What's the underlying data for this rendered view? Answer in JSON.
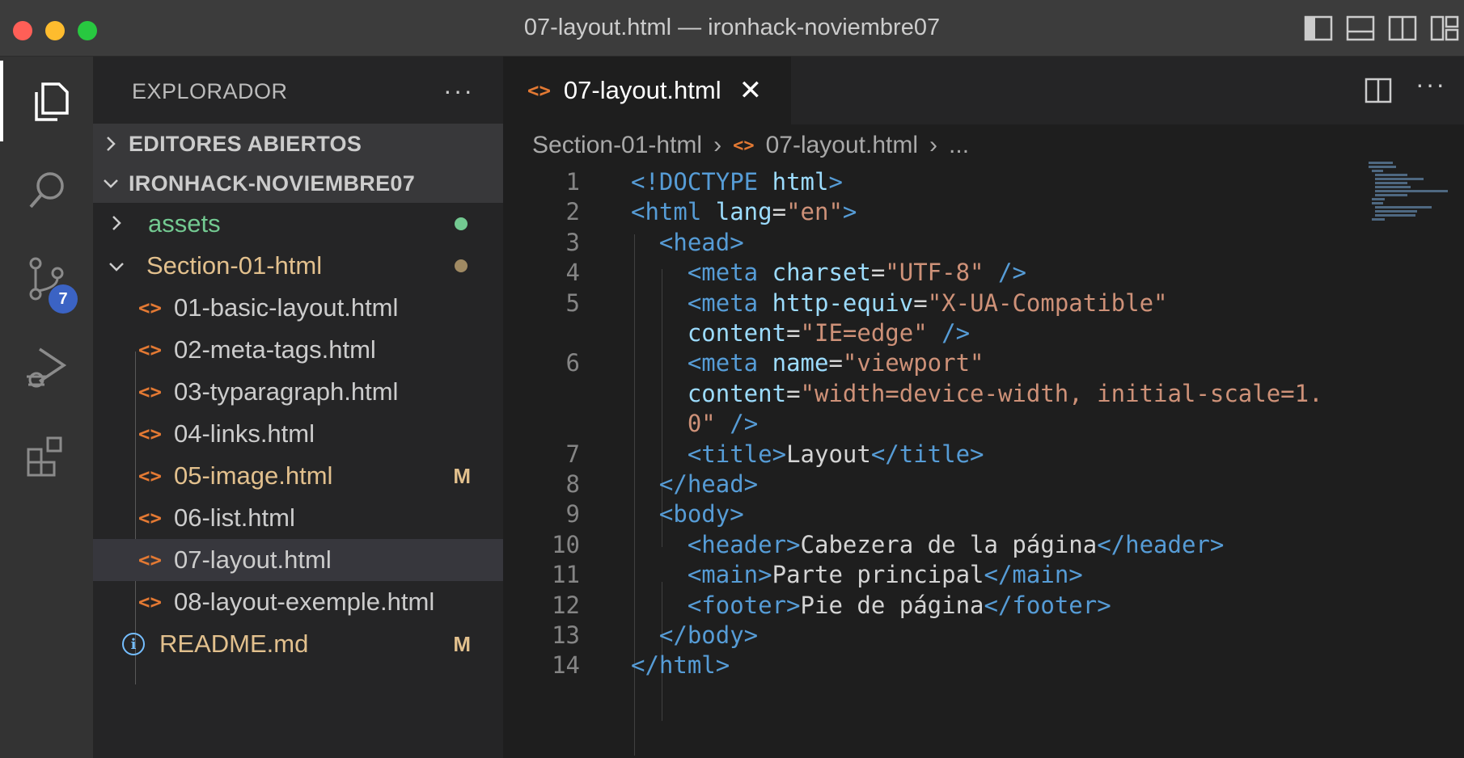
{
  "window": {
    "title": "07-layout.html — ironhack-noviembre07"
  },
  "activity_bar": {
    "items": [
      {
        "name": "explorer-icon"
      },
      {
        "name": "search-icon"
      },
      {
        "name": "source-control-icon",
        "badge": "7"
      },
      {
        "name": "run-debug-icon"
      },
      {
        "name": "extensions-icon"
      }
    ]
  },
  "sidebar": {
    "title": "EXPLORADOR",
    "more": "···",
    "sections": {
      "open_editors": "EDITORES ABIERTOS",
      "workspace": "IRONHACK-NOVIEMBRE07"
    },
    "tree": [
      {
        "name": "assets",
        "type": "folder",
        "collapsed": true,
        "color": "#73c991",
        "dot": "#73c991"
      },
      {
        "name": "Section-01-html",
        "type": "folder",
        "collapsed": false,
        "color": "#e2c08d",
        "dot": "#a08a63"
      },
      {
        "name": "01-basic-layout.html",
        "type": "file",
        "color": "#cccccc"
      },
      {
        "name": "02-meta-tags.html",
        "type": "file",
        "color": "#cccccc"
      },
      {
        "name": "03-typaragraph.html",
        "type": "file",
        "color": "#cccccc"
      },
      {
        "name": "04-links.html",
        "type": "file",
        "color": "#cccccc"
      },
      {
        "name": "05-image.html",
        "type": "file",
        "color": "#e2c08d",
        "decoration": "M"
      },
      {
        "name": "06-list.html",
        "type": "file",
        "color": "#cccccc"
      },
      {
        "name": "07-layout.html",
        "type": "file",
        "color": "#cccccc",
        "selected": true
      },
      {
        "name": "08-layout-exemple.html",
        "type": "file",
        "color": "#cccccc"
      },
      {
        "name": "README.md",
        "type": "info",
        "color": "#e2c08d",
        "decoration": "M"
      }
    ]
  },
  "editor": {
    "tab": {
      "label": "07-layout.html",
      "close": "✕"
    },
    "more": "···",
    "breadcrumb": {
      "folder": "Section-01-html",
      "file": "07-layout.html",
      "ellipsis": "..."
    },
    "lines": [
      {
        "n": "1",
        "segs": [
          [
            "t",
            "<!DOCTYPE "
          ],
          [
            "a",
            "html"
          ],
          [
            "t",
            ">"
          ]
        ]
      },
      {
        "n": "2",
        "segs": [
          [
            "t",
            "<html "
          ],
          [
            "a",
            "lang"
          ],
          [
            "w",
            "="
          ],
          [
            "s",
            "\"en\""
          ],
          [
            "t",
            ">"
          ]
        ]
      },
      {
        "n": "3",
        "segs": [
          [
            "w",
            "  "
          ],
          [
            "t",
            "<head>"
          ]
        ]
      },
      {
        "n": "4",
        "segs": [
          [
            "w",
            "    "
          ],
          [
            "t",
            "<meta "
          ],
          [
            "a",
            "charset"
          ],
          [
            "w",
            "="
          ],
          [
            "s",
            "\"UTF-8\""
          ],
          [
            "w",
            " "
          ],
          [
            "t",
            "/>"
          ]
        ]
      },
      {
        "n": "5",
        "segs": [
          [
            "w",
            "    "
          ],
          [
            "t",
            "<meta "
          ],
          [
            "a",
            "http-equiv"
          ],
          [
            "w",
            "="
          ],
          [
            "s",
            "\"X-UA-Compatible\""
          ]
        ]
      },
      {
        "n": "",
        "segs": [
          [
            "w",
            "    "
          ],
          [
            "a",
            "content"
          ],
          [
            "w",
            "="
          ],
          [
            "s",
            "\"IE=edge\""
          ],
          [
            "w",
            " "
          ],
          [
            "t",
            "/>"
          ]
        ]
      },
      {
        "n": "6",
        "segs": [
          [
            "w",
            "    "
          ],
          [
            "t",
            "<meta "
          ],
          [
            "a",
            "name"
          ],
          [
            "w",
            "="
          ],
          [
            "s",
            "\"viewport\""
          ]
        ]
      },
      {
        "n": "",
        "segs": [
          [
            "w",
            "    "
          ],
          [
            "a",
            "content"
          ],
          [
            "w",
            "="
          ],
          [
            "s",
            "\"width=device-width, initial-scale=1."
          ]
        ]
      },
      {
        "n": "",
        "segs": [
          [
            "w",
            "    "
          ],
          [
            "s",
            "0\""
          ],
          [
            "w",
            " "
          ],
          [
            "t",
            "/>"
          ]
        ]
      },
      {
        "n": "7",
        "segs": [
          [
            "w",
            "    "
          ],
          [
            "t",
            "<title>"
          ],
          [
            "w",
            "Layout"
          ],
          [
            "t",
            "</title>"
          ]
        ]
      },
      {
        "n": "8",
        "segs": [
          [
            "w",
            "  "
          ],
          [
            "t",
            "</head>"
          ]
        ]
      },
      {
        "n": "9",
        "segs": [
          [
            "w",
            "  "
          ],
          [
            "t",
            "<body>"
          ]
        ]
      },
      {
        "n": "10",
        "segs": [
          [
            "w",
            "    "
          ],
          [
            "t",
            "<header>"
          ],
          [
            "w",
            "Cabezera de la página"
          ],
          [
            "t",
            "</header>"
          ]
        ]
      },
      {
        "n": "11",
        "segs": [
          [
            "w",
            "    "
          ],
          [
            "t",
            "<main>"
          ],
          [
            "w",
            "Parte principal"
          ],
          [
            "t",
            "</main>"
          ]
        ]
      },
      {
        "n": "12",
        "segs": [
          [
            "w",
            "    "
          ],
          [
            "t",
            "<footer>"
          ],
          [
            "w",
            "Pie de página"
          ],
          [
            "t",
            "</footer>"
          ]
        ]
      },
      {
        "n": "13",
        "segs": [
          [
            "w",
            "  "
          ],
          [
            "t",
            "</body>"
          ]
        ]
      },
      {
        "n": "14",
        "segs": [
          [
            "t",
            "</html>"
          ]
        ]
      }
    ]
  }
}
